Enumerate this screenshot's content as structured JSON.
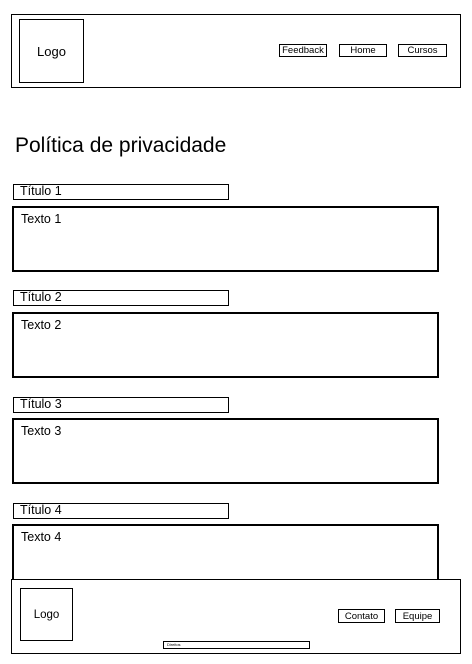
{
  "header": {
    "logo": "Logo",
    "nav": [
      "Feedback",
      "Home",
      "Cursos"
    ]
  },
  "page_title": "Política de privacidade",
  "sections": [
    {
      "title": "Título 1",
      "text": "Texto 1"
    },
    {
      "title": "Título 2",
      "text": "Texto 2"
    },
    {
      "title": "Título 3",
      "text": "Texto 3"
    },
    {
      "title": "Título 4",
      "text": "Texto 4"
    }
  ],
  "footer": {
    "logo": "Logo",
    "nav": [
      "Contato",
      "Equipe"
    ],
    "rights": "Direitos"
  }
}
